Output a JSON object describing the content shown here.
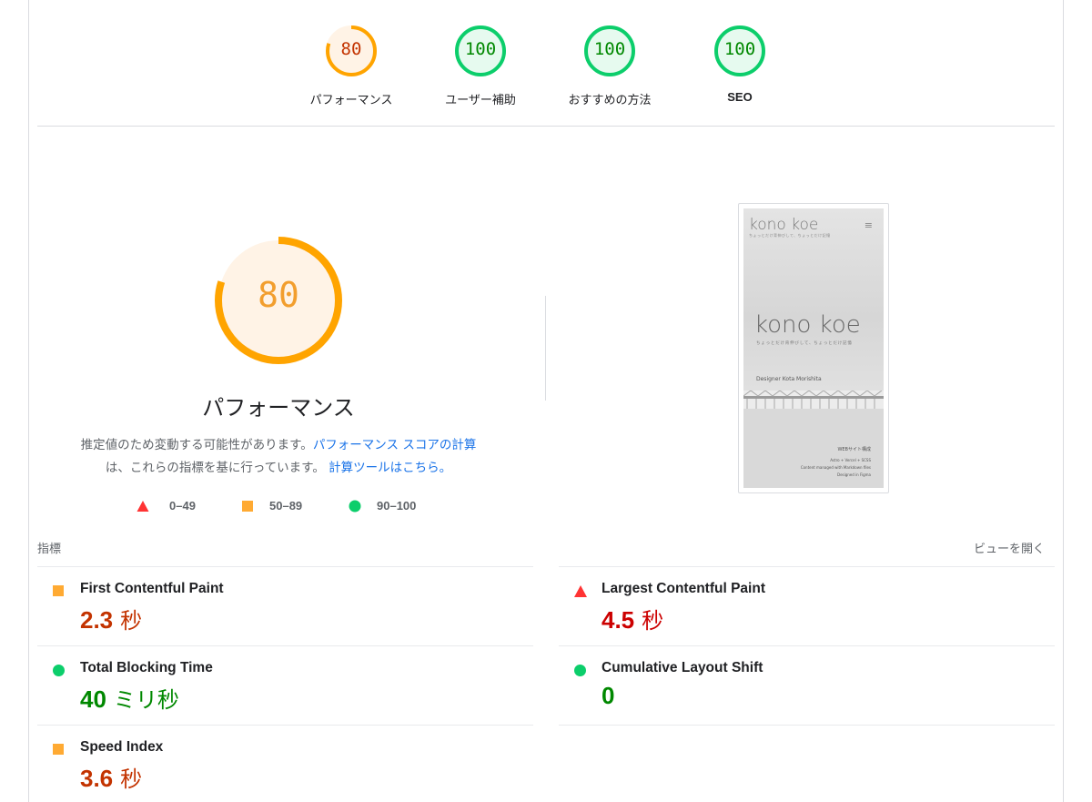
{
  "summary": {
    "gauges": [
      {
        "label": "パフォーマンス",
        "score": "80",
        "status": "average"
      },
      {
        "label": "ユーザー補助",
        "score": "100",
        "status": "pass"
      },
      {
        "label": "おすすめの方法",
        "score": "100",
        "status": "pass"
      },
      {
        "label": "SEO",
        "score": "100",
        "status": "pass"
      }
    ]
  },
  "main_gauge": {
    "score": "80",
    "score_fraction": 0.8,
    "title": "パフォーマンス",
    "description_prefix": "推定値のため変動する可能性があります。",
    "description_link1": "パフォーマンス スコアの計算",
    "description_mid": "は、これらの指標を基に行っています。",
    "description_link2": "計算ツールはこちら。"
  },
  "legend": [
    {
      "range": "0–49",
      "shape": "triangle",
      "color": "#ff3333"
    },
    {
      "range": "50–89",
      "shape": "square",
      "color": "#ffaa33"
    },
    {
      "range": "90–100",
      "shape": "circle",
      "color": "#0cce6b"
    }
  ],
  "thumbnail": {
    "logo": "kono koe",
    "menu": "≡",
    "subtitle": "ちょっとだけ背伸びして、ちょっとだけ記憶",
    "hero": "kono koe",
    "hero_sub": "ちょっとだけ背伸びして、ちょっとだけ記憶",
    "designer": "Designer Kota Morishita",
    "web_label": "WEBサイト構成",
    "tech": [
      "Astro + Vercel + SCSS",
      "Content managed with Markdown files",
      "Designed in Figma"
    ]
  },
  "metrics_section": {
    "label": "指標",
    "view_toggle": "ビューを開く",
    "items": [
      {
        "name": "First Contentful Paint",
        "value": "2.3",
        "unit": "秒",
        "status": "average"
      },
      {
        "name": "Largest Contentful Paint",
        "value": "4.5",
        "unit": "秒",
        "status": "fail"
      },
      {
        "name": "Total Blocking Time",
        "value": "40",
        "unit": "ミリ秒",
        "status": "pass"
      },
      {
        "name": "Cumulative Layout Shift",
        "value": "0",
        "unit": "",
        "status": "pass"
      },
      {
        "name": "Speed Index",
        "value": "3.6",
        "unit": "秒",
        "status": "average"
      }
    ]
  },
  "colors": {
    "average_stroke": "#ffa400",
    "average_fill": "#fff3e6",
    "average_text": "#c33300",
    "pass_stroke": "#0cce6b",
    "pass_fill": "#e6faef",
    "pass_text": "#008800",
    "fail": "#ff3333",
    "link": "#1a73e8"
  }
}
